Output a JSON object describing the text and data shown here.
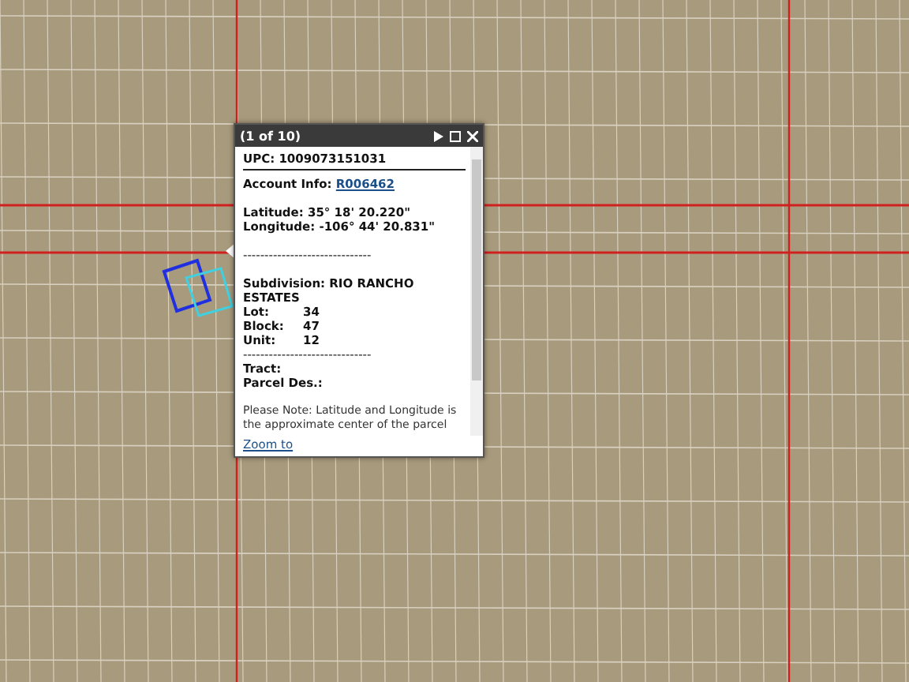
{
  "popup": {
    "title": "(1 of 10)",
    "upc": "UPC: 1009073151031",
    "account_label": "Account Info:",
    "account_link": "R006462",
    "latitude": "Latitude: 35° 18' 20.220\"",
    "longitude": "Longitude: -106° 44' 20.831\"",
    "divider": "------------------------------",
    "subdivision": "Subdivision: RIO RANCHO ESTATES",
    "rows": [
      {
        "label": "Lot:",
        "value": "34"
      },
      {
        "label": "Block:",
        "value": "47"
      },
      {
        "label": "Unit:",
        "value": "12"
      }
    ],
    "divider_2": "------------------------------",
    "extra": [
      "Tract:",
      "Parcel Des.:"
    ],
    "note": "Please Note: Latitude and Longitude is the approximate center of the parcel",
    "zoom_link": "Zoom to"
  }
}
